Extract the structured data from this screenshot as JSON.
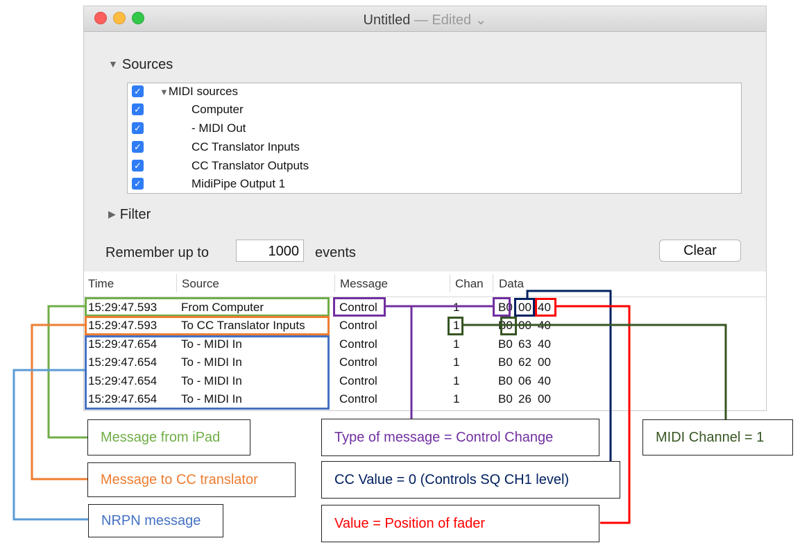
{
  "window": {
    "title": "Untitled",
    "edited": "— Edited",
    "edited_chevron": "⌄"
  },
  "sources": {
    "label": "Sources",
    "items": [
      {
        "label": "MIDI sources",
        "checked": true
      },
      {
        "label": "Computer",
        "checked": true
      },
      {
        "label": "- MIDI Out",
        "checked": true
      },
      {
        "label": "CC Translator Inputs",
        "checked": true
      },
      {
        "label": "CC Translator Outputs",
        "checked": true
      },
      {
        "label": "MidiPipe Output 1",
        "checked": true
      }
    ]
  },
  "filter": {
    "label": "Filter"
  },
  "remember": {
    "prefix": "Remember up to",
    "value": "1000",
    "suffix": "events"
  },
  "clear_label": "Clear",
  "table": {
    "columns": [
      "Time",
      "Source",
      "Message",
      "Chan",
      "Data"
    ],
    "rows": [
      {
        "time": "15:29:47.593",
        "source": "From Computer",
        "message": "Control",
        "chan": "1",
        "d1": "B0",
        "d2": "00",
        "d3": "40"
      },
      {
        "time": "15:29:47.593",
        "source": "To CC Translator Inputs",
        "message": "Control",
        "chan": "1",
        "d1": "B0",
        "d2": "00",
        "d3": "40"
      },
      {
        "time": "15:29:47.654",
        "source": "To - MIDI In",
        "message": "Control",
        "chan": "1",
        "d1": "B0",
        "d2": "63",
        "d3": "40"
      },
      {
        "time": "15:29:47.654",
        "source": "To - MIDI In",
        "message": "Control",
        "chan": "1",
        "d1": "B0",
        "d2": "62",
        "d3": "00"
      },
      {
        "time": "15:29:47.654",
        "source": "To - MIDI In",
        "message": "Control",
        "chan": "1",
        "d1": "B0",
        "d2": "06",
        "d3": "40"
      },
      {
        "time": "15:29:47.654",
        "source": "To - MIDI In",
        "message": "Control",
        "chan": "1",
        "d1": "B0",
        "d2": "26",
        "d3": "00"
      }
    ]
  },
  "annotations": {
    "from_ipad": "Message from iPad",
    "to_cc": "Message to CC translator",
    "nrpn": "NRPN message",
    "type": "Type of message = Control Change",
    "cc_value": "CC Value = 0 (Controls SQ CH1 level)",
    "value": "Value = Position of fader",
    "channel": "MIDI Channel = 1"
  },
  "colors": {
    "green": "#70ad47",
    "orange": "#ed7d31",
    "blue": "#4472c4",
    "light_blue": "#5b9bd5",
    "purple": "#7030a0",
    "navy": "#002060",
    "red": "#ff0000",
    "dark_green": "#375623"
  }
}
